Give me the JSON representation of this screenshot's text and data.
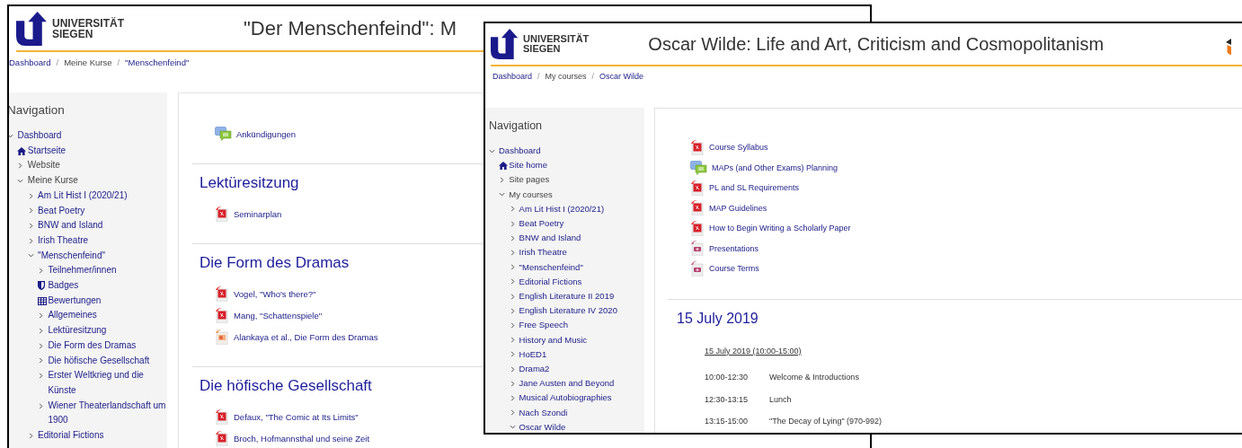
{
  "windows": [
    {
      "logo": {
        "line_1": "UNIVERSITÄT",
        "line_2": "SIEGEN"
      },
      "title": "\"Der Menschenfeind\": M",
      "breadcrumb": [
        {
          "label": "Dashboard",
          "kind": "link"
        },
        {
          "label": "/",
          "kind": "separator"
        },
        {
          "label": "Meine Kurse",
          "kind": "text"
        },
        {
          "label": "/",
          "kind": "separator"
        },
        {
          "label": "\"Menschenfeind\"",
          "kind": "link"
        }
      ],
      "navigation": {
        "heading": "Navigation",
        "items": [
          {
            "label": "Dashboard",
            "kind": "link",
            "expanded": true,
            "children": [
              {
                "label": "Startseite",
                "kind": "home"
              },
              {
                "label": "Website",
                "kind": "category",
                "expanded": false
              },
              {
                "label": "Meine Kurse",
                "kind": "category",
                "expanded": true,
                "children": [
                  {
                    "label": "Am Lit Hist I (2020/21)",
                    "kind": "link",
                    "expanded": false
                  },
                  {
                    "label": "Beat Poetry",
                    "kind": "link",
                    "expanded": false
                  },
                  {
                    "label": "BNW and Island",
                    "kind": "link",
                    "expanded": false
                  },
                  {
                    "label": "Irish Theatre",
                    "kind": "link",
                    "expanded": false
                  },
                  {
                    "label": "\"Menschenfeind\"",
                    "kind": "link",
                    "expanded": true,
                    "children": [
                      {
                        "label": "Teilnehmer/innen",
                        "kind": "link",
                        "expanded": false
                      },
                      {
                        "label": "Badges",
                        "kind": "badges"
                      },
                      {
                        "label": "Bewertungen",
                        "kind": "grades"
                      },
                      {
                        "label": "Allgemeines",
                        "kind": "link",
                        "expanded": false
                      },
                      {
                        "label": "Lektüresitzung",
                        "kind": "link",
                        "expanded": false
                      },
                      {
                        "label": "Die Form des Dramas",
                        "kind": "link",
                        "expanded": false
                      },
                      {
                        "label": "Die höfische Gesellschaft",
                        "kind": "link",
                        "expanded": false
                      },
                      {
                        "label": "Erster Weltkrieg und die Künste",
                        "kind": "link",
                        "expanded": false
                      },
                      {
                        "label": "Wiener Theaterlandschaft um 1900",
                        "kind": "link",
                        "expanded": false
                      }
                    ]
                  },
                  {
                    "label": "Editorial Fictions",
                    "kind": "link",
                    "expanded": false
                  }
                ]
              }
            ]
          }
        ]
      },
      "sections": [
        {
          "items": [
            {
              "label": "Ankündigungen",
              "kind": "forum"
            }
          ]
        },
        {
          "heading": "Lektüresitzung",
          "items": [
            {
              "label": "Seminarplan",
              "kind": "pdf"
            }
          ]
        },
        {
          "heading": "Die Form des Dramas",
          "items": [
            {
              "label": "Vogel, \"Who's there?\"",
              "kind": "pdf"
            },
            {
              "label": "Mang, \"Schattenspiele\"",
              "kind": "pdf"
            },
            {
              "label": "Alankaya et al., Die Form des Dramas",
              "kind": "slides"
            }
          ]
        },
        {
          "heading": "Die höfische Gesellschaft",
          "items": [
            {
              "label": "Defaux, \"The Comic at Its Limits\"",
              "kind": "pdf"
            },
            {
              "label": "Broch, Hofmannsthal und seine Zeit",
              "kind": "pdf"
            }
          ]
        }
      ]
    },
    {
      "logo": {
        "line_1": "UNIVERSITÄT",
        "line_2": "SIEGEN"
      },
      "title": "Oscar Wilde: Life and Art, Criticism and Cosmopolitanism",
      "breadcrumb": [
        {
          "label": "Dashboard",
          "kind": "link"
        },
        {
          "label": "/",
          "kind": "separator"
        },
        {
          "label": "My courses",
          "kind": "text"
        },
        {
          "label": "/",
          "kind": "separator"
        },
        {
          "label": "Oscar Wilde",
          "kind": "link"
        }
      ],
      "navigation": {
        "heading": "Navigation",
        "items": [
          {
            "label": "Dashboard",
            "kind": "link",
            "expanded": true,
            "children": [
              {
                "label": "Site home",
                "kind": "home"
              },
              {
                "label": "Site pages",
                "kind": "category",
                "expanded": false
              },
              {
                "label": "My courses",
                "kind": "category",
                "expanded": true,
                "children": [
                  {
                    "label": "Am Lit Hist I (2020/21)",
                    "kind": "link",
                    "expanded": false
                  },
                  {
                    "label": "Beat Poetry",
                    "kind": "link",
                    "expanded": false
                  },
                  {
                    "label": "BNW and Island",
                    "kind": "link",
                    "expanded": false
                  },
                  {
                    "label": "Irish Theatre",
                    "kind": "link",
                    "expanded": false
                  },
                  {
                    "label": "\"Menschenfeind\"",
                    "kind": "link",
                    "expanded": false
                  },
                  {
                    "label": "Editorial Fictions",
                    "kind": "link",
                    "expanded": false
                  },
                  {
                    "label": "English Literature II 2019",
                    "kind": "link",
                    "expanded": false
                  },
                  {
                    "label": "English Literature IV 2020",
                    "kind": "link",
                    "expanded": false
                  },
                  {
                    "label": "Free Speech",
                    "kind": "link",
                    "expanded": false
                  },
                  {
                    "label": "History and Music",
                    "kind": "link",
                    "expanded": false
                  },
                  {
                    "label": "HoED1",
                    "kind": "link",
                    "expanded": false
                  },
                  {
                    "label": "Drama2",
                    "kind": "link",
                    "expanded": false
                  },
                  {
                    "label": "Jane Austen and Beyond",
                    "kind": "link",
                    "expanded": false
                  },
                  {
                    "label": "Musical Autobiographies",
                    "kind": "link",
                    "expanded": false
                  },
                  {
                    "label": "Nach Szondi",
                    "kind": "link",
                    "expanded": false
                  },
                  {
                    "label": "Oscar Wilde",
                    "kind": "link",
                    "expanded": true
                  }
                ]
              }
            ]
          }
        ]
      },
      "sections": [
        {
          "items": [
            {
              "label": "Course Syllabus",
              "kind": "pdf"
            },
            {
              "label": "MAPs (and Other Exams) Planning",
              "kind": "forum"
            },
            {
              "label": "PL and SL Requirements",
              "kind": "pdf"
            },
            {
              "label": "MAP Guidelines",
              "kind": "pdf"
            },
            {
              "label": "How to Begin Writing a Scholarly Paper",
              "kind": "pdf"
            },
            {
              "label": "Presentations",
              "kind": "media"
            },
            {
              "label": "Course Terms",
              "kind": "media"
            }
          ]
        },
        {
          "heading": "15 July 2019",
          "schedule": {
            "title": "15 July 2019 (10:00-15:00)",
            "rows": [
              {
                "time": "10:00-12:30",
                "activity": "Welcome & Introductions"
              },
              {
                "time": "12:30-13:15",
                "activity": "Lunch"
              },
              {
                "time": "13:15-15:00",
                "activity": "\"The Decay of Lying\" (970-992)"
              }
            ]
          }
        }
      ]
    }
  ]
}
